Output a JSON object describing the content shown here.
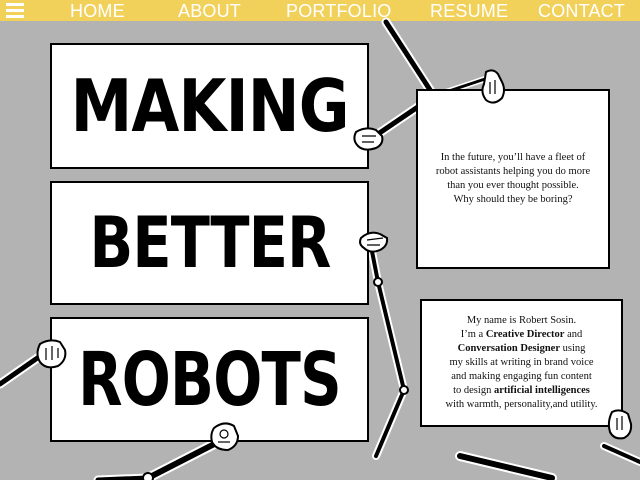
{
  "nav": {
    "menu_icon": "hamburger-menu-icon",
    "links": [
      "HOME",
      "ABOUT",
      "PORTFOLIO",
      "RESUME",
      "CONTACT"
    ]
  },
  "headline": {
    "line1": "MAKING",
    "line2": "BETTER",
    "line3": "ROBOTS"
  },
  "card_future": {
    "line1": "In the future, you’ll have a fleet of",
    "line2": "robot assistants helping you do more",
    "line3": "than you ever thought possible.",
    "line4": "Why should they be boring?"
  },
  "card_bio": {
    "line1": "My name is Robert Sosin.",
    "line2_pre": "I’m a ",
    "line2_bold": "Creative Director",
    "line2_post": " and",
    "line3_bold": "Conversation Designer",
    "line3_post": " using",
    "line4": "my skills at writing in brand voice",
    "line5": "and making engaging fun content",
    "line6_pre": "to design ",
    "line6_bold": "artificial intelligences",
    "line7": "with warmth, personality,and utility."
  },
  "colors": {
    "nav_background": "#f2d15b",
    "page_background": "#b3b3b3",
    "panel_background": "#ffffff",
    "text": "#000000"
  },
  "decor": {
    "arm_icon": "robot-arm-icon",
    "hand_icon": "cartoon-glove-hand-icon"
  }
}
